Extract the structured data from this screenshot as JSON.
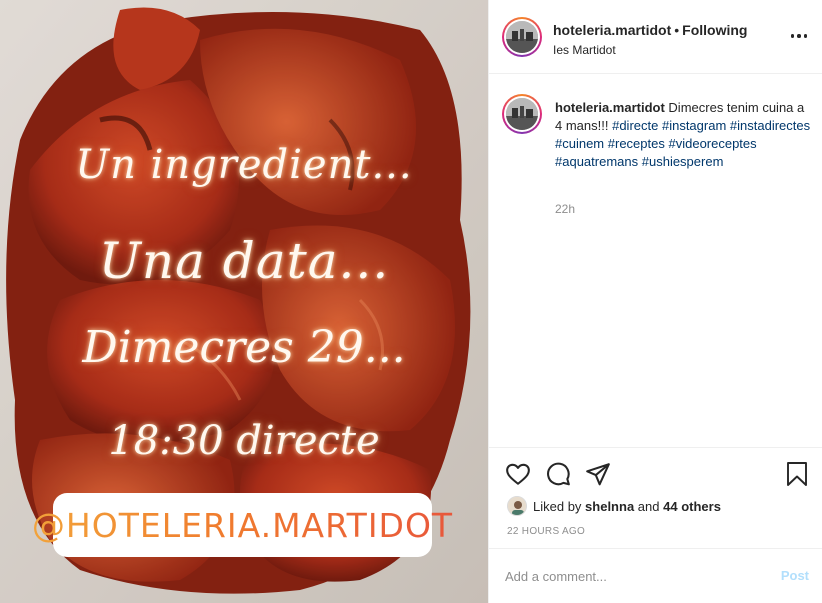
{
  "post": {
    "overlay_lines": [
      "Un ingredient...",
      "Una data...",
      "Dimecres 29...",
      "18:30 directe"
    ],
    "overlay_handle": "@HOTELERIA.MARTIDOT"
  },
  "header": {
    "username": "hoteleria.martidot",
    "separator": "•",
    "follow_status": "Following",
    "location": "Ies Martidot",
    "more_icon": "more-options-icon"
  },
  "caption": {
    "username": "hoteleria.martidot",
    "text": "Dimecres tenim cuina a 4 mans!!!",
    "hashtags": [
      "#directe",
      "#instagram",
      "#instadirectes",
      "#cuinem",
      "#receptes",
      "#videoreceptes",
      "#aquatremans",
      "#ushiesperem"
    ],
    "age": "22h"
  },
  "actions": {
    "icons": [
      "heart-icon",
      "comment-icon",
      "share-icon",
      "bookmark-icon"
    ],
    "liked_by_prefix": "Liked by",
    "liked_by_user": "shelnna",
    "liked_by_and": "and",
    "liked_by_others": "44 others",
    "timestamp": "22 HOURS AGO"
  },
  "comment": {
    "placeholder": "Add a comment...",
    "post_label": "Post"
  },
  "colors": {
    "hashtag": "#00376b",
    "post_button_disabled": "#b2dffc",
    "pepper_red": "#c8341c",
    "muted_text": "#8e8e8e"
  }
}
